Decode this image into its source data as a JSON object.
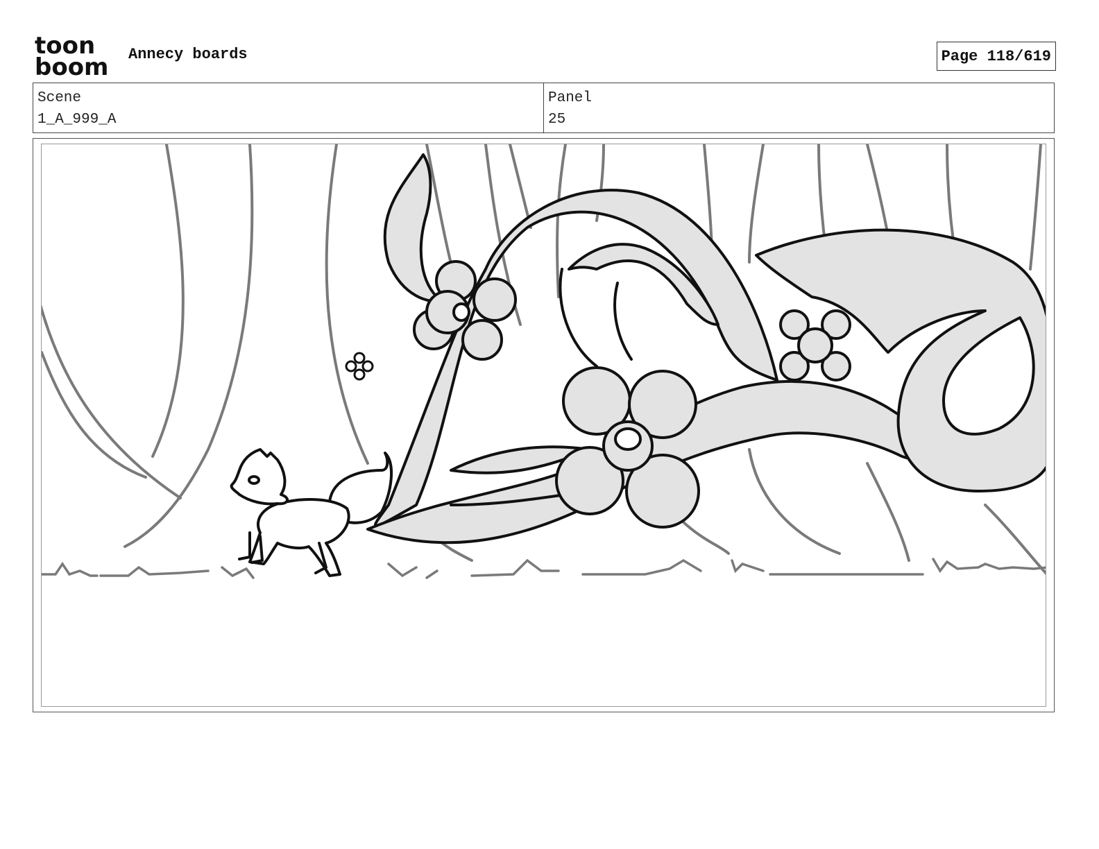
{
  "header": {
    "logo_line1": "toon",
    "logo_line2": "boom",
    "project_title": "Annecy boards",
    "page_indicator": "Page 118/619"
  },
  "meta": {
    "scene_label": "Scene",
    "scene_value": "1_A_999_A",
    "panel_label": "Panel",
    "panel_value": "25"
  }
}
